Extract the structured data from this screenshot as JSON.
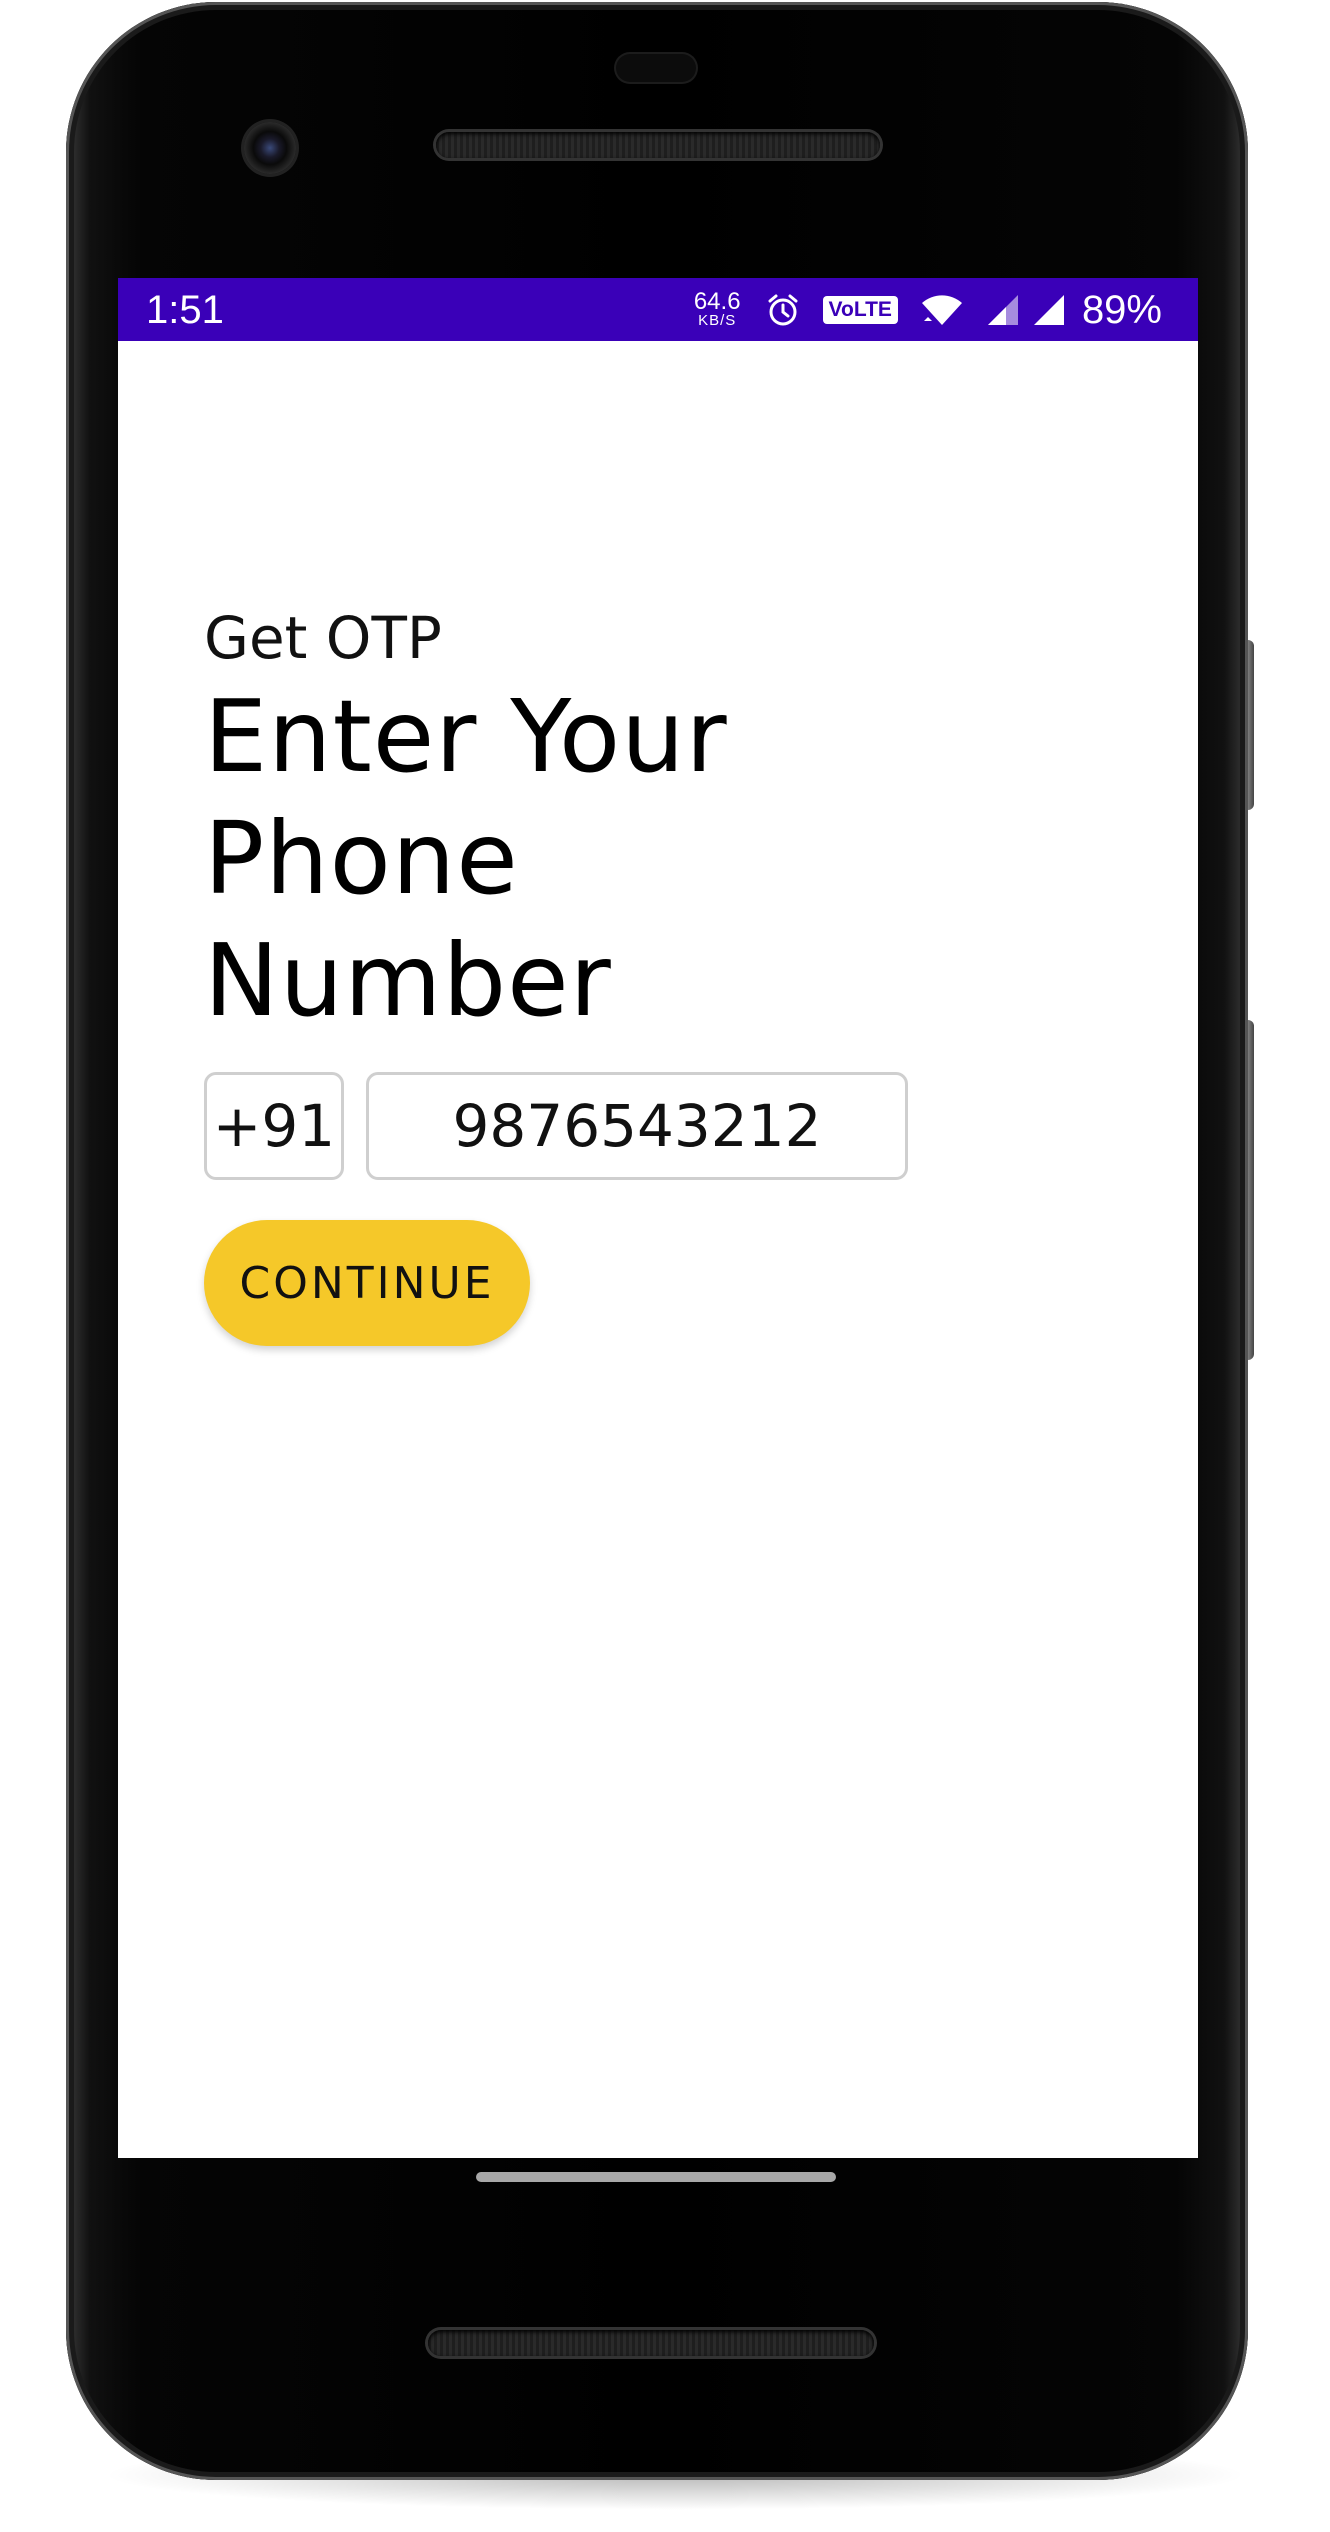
{
  "status_bar": {
    "time": "1:51",
    "network_speed_value": "64.6",
    "network_speed_unit": "KB/S",
    "volte_label": "VoLTE",
    "battery_percent": "89%",
    "icons": [
      "alarm-icon",
      "volte-icon",
      "wifi-icon",
      "signal-icon",
      "signal-icon"
    ],
    "background_color": "#3a00b8"
  },
  "screen": {
    "subtitle": "Get OTP",
    "title": "Enter Your Phone Number",
    "country_code": "+91",
    "phone_number": "9876543212",
    "continue_label": "CONTINUE",
    "accent_color": "#f5c829"
  }
}
